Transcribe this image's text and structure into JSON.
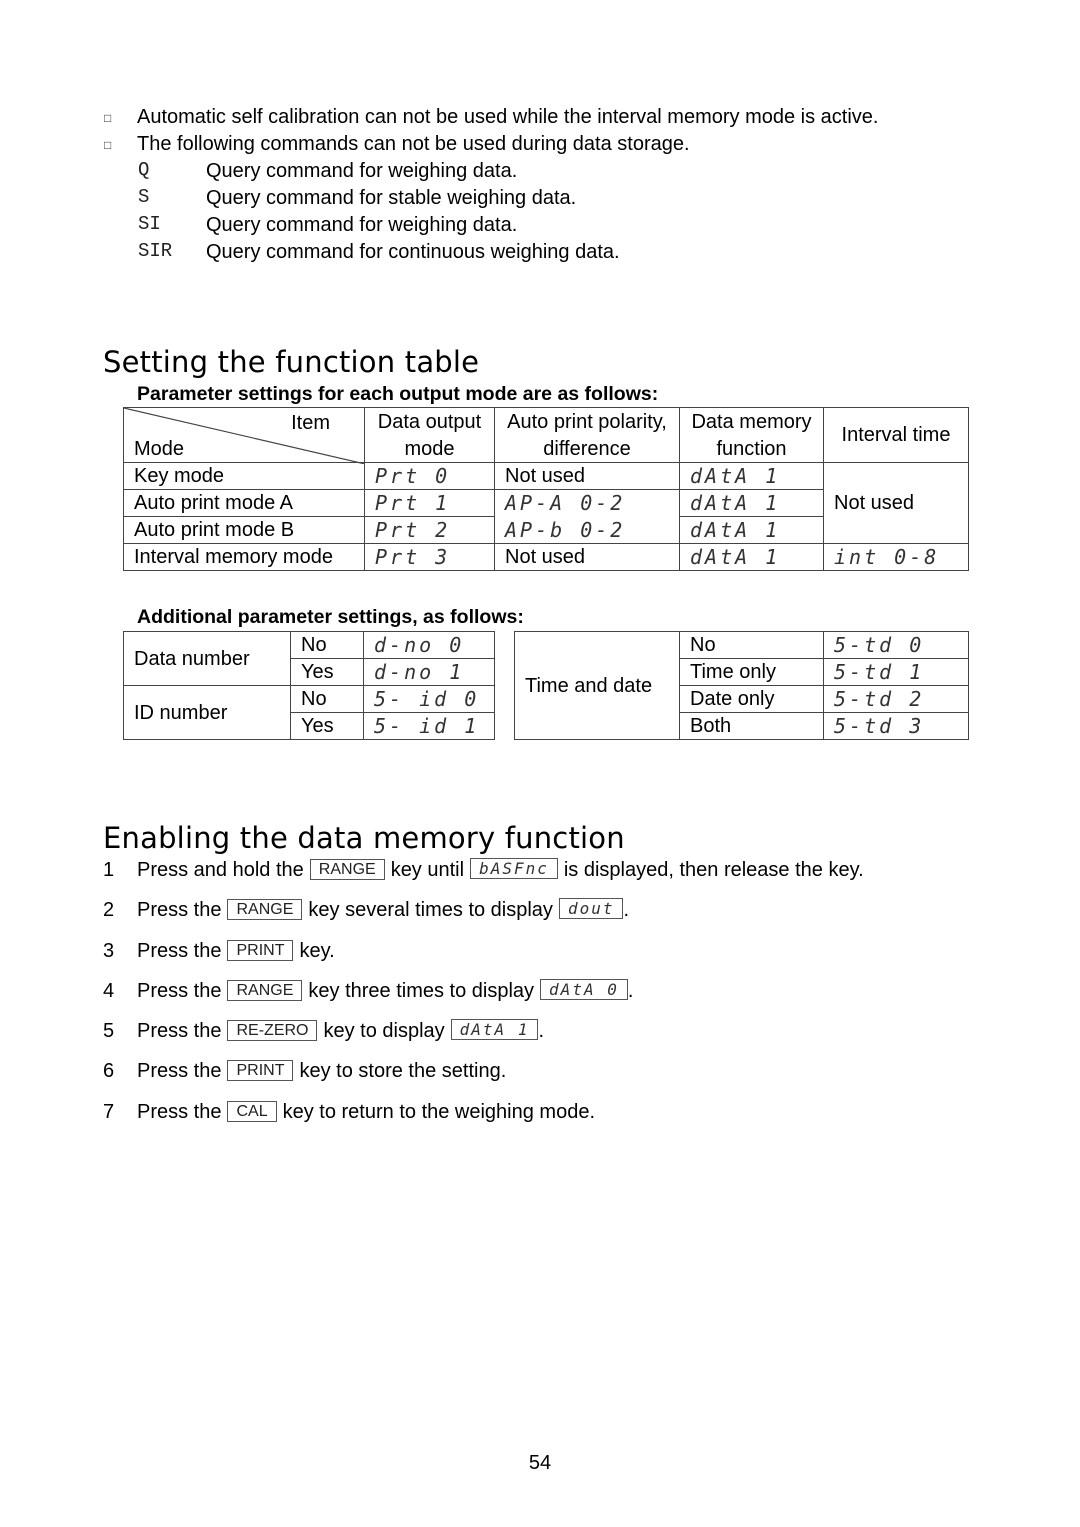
{
  "notes": {
    "bullets": [
      "Automatic self calibration can not be used while the interval memory mode is active.",
      "The following commands can not be used during data storage."
    ],
    "commands": [
      {
        "code": "Q",
        "desc": "Query command for weighing data."
      },
      {
        "code": "S",
        "desc": "Query command for stable weighing data."
      },
      {
        "code": "SI",
        "desc": "Query command for weighing data."
      },
      {
        "code": "SIR",
        "desc": "Query command for continuous weighing data."
      }
    ]
  },
  "function_table": {
    "title": "Setting the function table",
    "subtitle": "Parameter settings for each output mode are as follows:",
    "header": {
      "item": "Item",
      "mode": "Mode",
      "data_output_1": "Data output",
      "data_output_2": "mode",
      "polarity_1": "Auto print polarity,",
      "polarity_2": "difference",
      "memory_1": "Data memory",
      "memory_2": "function",
      "interval": "Interval time"
    },
    "rows": [
      {
        "mode": "Key mode",
        "output": "Prt 0",
        "polarity": "Not used",
        "memory": "dAtA 1"
      },
      {
        "mode": "Auto print mode A",
        "output": "Prt 1",
        "polarity": "AP-A 0-2",
        "memory": "dAtA 1"
      },
      {
        "mode": "Auto print mode B",
        "output": "Prt 2",
        "polarity": "AP-b 0-2",
        "memory": "dAtA 1"
      },
      {
        "mode": "Interval memory mode",
        "output": "Prt 3",
        "polarity": "Not used",
        "memory": "dAtA 1"
      }
    ],
    "interval_not_used": "Not used",
    "interval_memory_value": "int 0-8"
  },
  "additional": {
    "subtitle": "Additional parameter settings, as follows:",
    "data_number": {
      "label": "Data number",
      "options": [
        {
          "opt": "No",
          "code": "d-no 0"
        },
        {
          "opt": "Yes",
          "code": "d-no 1"
        }
      ]
    },
    "id_number": {
      "label": "ID number",
      "options": [
        {
          "opt": "No",
          "code": "5- id 0"
        },
        {
          "opt": "Yes",
          "code": "5- id 1"
        }
      ]
    },
    "time_date": {
      "label": "Time and date",
      "options": [
        {
          "opt": "No",
          "code": "5-td 0"
        },
        {
          "opt": "Time only",
          "code": "5-td 1"
        },
        {
          "opt": "Date only",
          "code": "5-td 2"
        },
        {
          "opt": "Both",
          "code": "5-td 3"
        }
      ]
    }
  },
  "memory_enable": {
    "title": "Enabling the data memory function",
    "steps": [
      {
        "n": "1",
        "a": "Press and hold the",
        "key": "RANGE",
        "b": "key until",
        "disp": "bASFnc",
        "c": "is displayed, then release the key."
      },
      {
        "n": "2",
        "a": "Press the",
        "key": "RANGE",
        "b": "key several times to display",
        "disp": "dout",
        "c": "."
      },
      {
        "n": "3",
        "a": "Press the",
        "key": "PRINT",
        "b": "key."
      },
      {
        "n": "4",
        "a": "Press the",
        "key": "RANGE",
        "b": "key three times to display",
        "disp": "dAtA 0",
        "c": "."
      },
      {
        "n": "5",
        "a": "Press the",
        "key": "RE-ZERO",
        "b": "key to display",
        "disp": "dAtA 1",
        "c": "."
      },
      {
        "n": "6",
        "a": "Press the",
        "key": "PRINT",
        "b": "key to store the setting."
      },
      {
        "n": "7",
        "a": "Press the",
        "key": "CAL",
        "b": "key to return to the weighing mode."
      }
    ]
  },
  "page_number": "54"
}
